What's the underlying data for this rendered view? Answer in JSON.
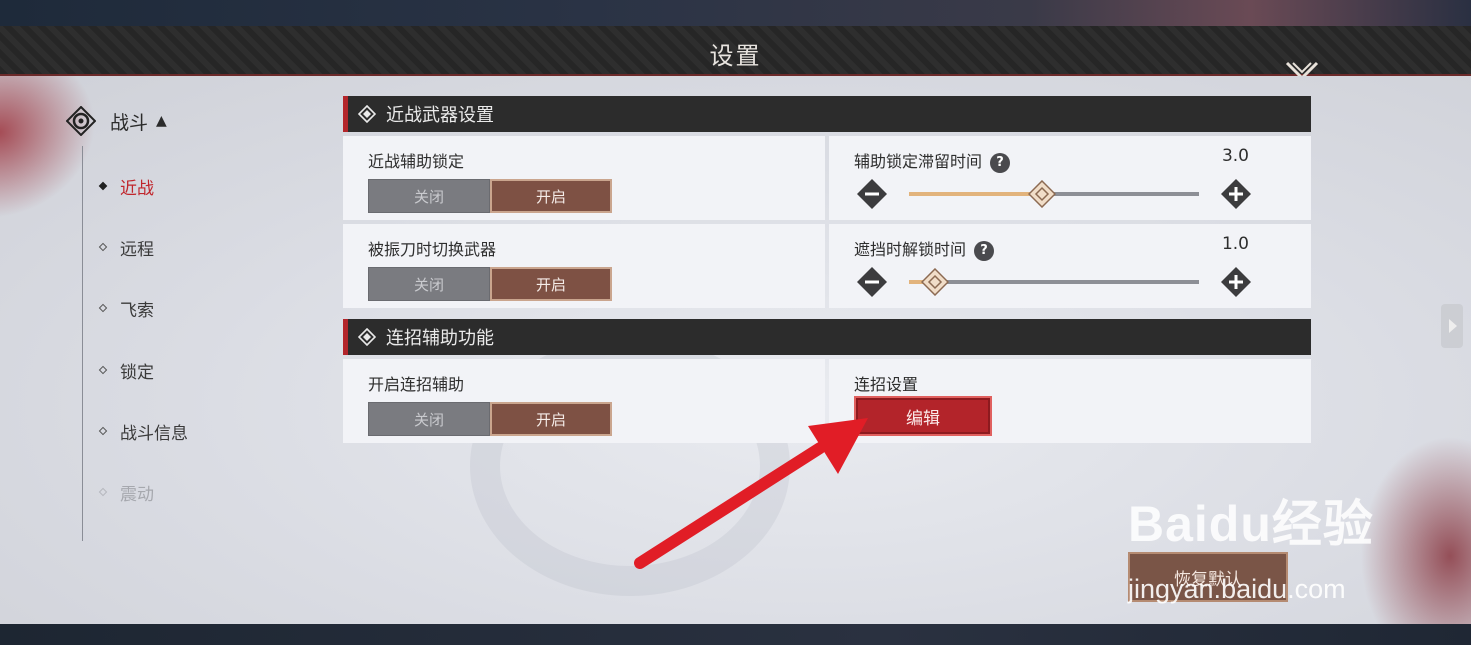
{
  "header": {
    "title": "设置"
  },
  "sidebar": {
    "category": "战斗",
    "items": [
      {
        "label": "近战",
        "state": "active"
      },
      {
        "label": "远程",
        "state": "normal"
      },
      {
        "label": "飞索",
        "state": "normal"
      },
      {
        "label": "锁定",
        "state": "normal"
      },
      {
        "label": "战斗信息",
        "state": "normal"
      },
      {
        "label": "震动",
        "state": "disabled"
      }
    ]
  },
  "sections": [
    {
      "title": "近战武器设置",
      "settings": [
        {
          "label": "近战辅助锁定",
          "off_label": "关闭",
          "on_label": "开启",
          "selected": "on"
        },
        {
          "label": "辅助锁定滞留时间",
          "value": "3.0",
          "fraction": 0.46
        },
        {
          "label": "被振刀时切换武器",
          "off_label": "关闭",
          "on_label": "开启",
          "selected": "on"
        },
        {
          "label": "遮挡时解锁时间",
          "value": "1.0",
          "fraction": 0.09
        }
      ]
    },
    {
      "title": "连招辅助功能",
      "settings": [
        {
          "label": "开启连招辅助",
          "off_label": "关闭",
          "on_label": "开启",
          "selected": "on"
        },
        {
          "label": "连招设置",
          "button_label": "编辑"
        }
      ]
    }
  ],
  "footer": {
    "reset_label": "恢复默认"
  },
  "watermark": {
    "brand": "Baidu经验",
    "url": "jingyan.baidu.com"
  },
  "colors": {
    "accent_red": "#b3242a",
    "toggle_on": "#7e5144",
    "slider_fill": "#e2b37c",
    "annotation_arrow": "#e11d26"
  }
}
